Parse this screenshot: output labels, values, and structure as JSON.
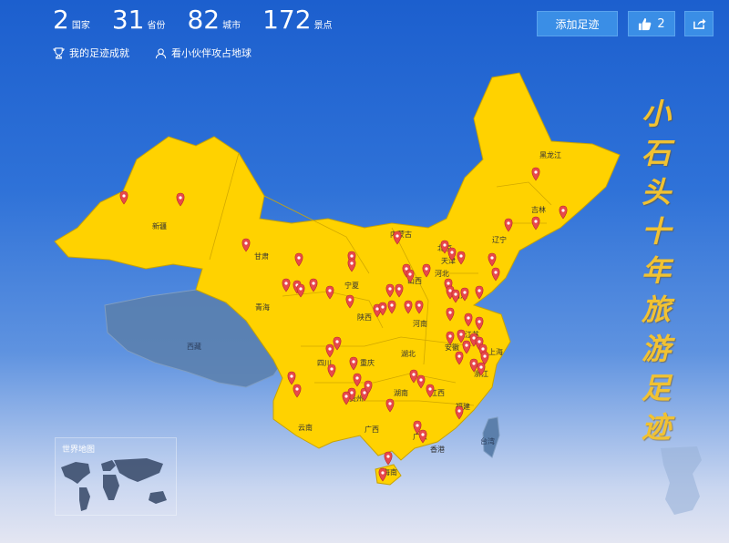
{
  "stats": [
    {
      "value": "2",
      "unit": "国家"
    },
    {
      "value": "31",
      "unit": "省份"
    },
    {
      "value": "82",
      "unit": "城市"
    },
    {
      "value": "172",
      "unit": "景点"
    }
  ],
  "links": {
    "achievements": "我的足迹成就",
    "friends": "看小伙伴攻占地球"
  },
  "buttons": {
    "add_footprint": "添加足迹",
    "like_count": "2"
  },
  "title_chars": [
    "小",
    "石",
    "头",
    "十",
    "年",
    "旅",
    "游",
    "足",
    "迹"
  ],
  "world_map": {
    "label": "世界地图"
  },
  "provinces": [
    "黑龙江",
    "吉林",
    "辽宁",
    "内蒙古",
    "新疆",
    "甘肃",
    "宁夏",
    "青海",
    "西藏",
    "陕西",
    "山西",
    "河北",
    "北京",
    "天津",
    "山东",
    "河南",
    "湖北",
    "安徽",
    "江苏",
    "上海",
    "浙江",
    "四川",
    "重庆",
    "贵州",
    "湖南",
    "江西",
    "福建",
    "云南",
    "广西",
    "广东",
    "海南",
    "香港",
    "台湾"
  ],
  "colors": {
    "visited": "#ffd200",
    "unvisited": "#5b7fab",
    "pin": "#e8494b",
    "button": "#3a8ee6"
  }
}
